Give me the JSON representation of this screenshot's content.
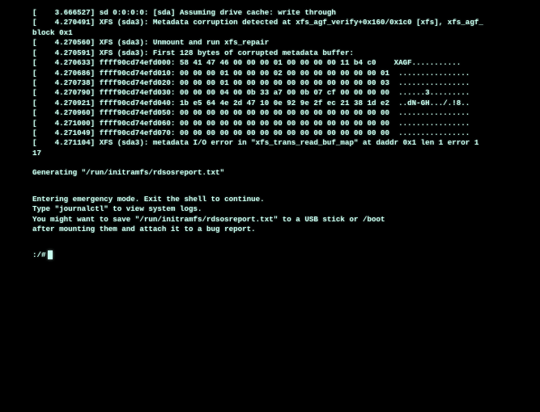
{
  "lines": [
    "[    3.666527] sd 0:0:0:0: [sda] Assuming drive cache: write through",
    "[    4.270491] XFS (sda3): Metadata corruption detected at xfs_agf_verify+0x160/0x1c0 [xfs], xfs_agf_",
    "block 0x1",
    "[    4.270560] XFS (sda3): Unmount and run xfs_repair",
    "[    4.270591] XFS (sda3): First 128 bytes of corrupted metadata buffer:",
    "[    4.270633] ffff90cd74efd000: 58 41 47 46 00 00 00 01 00 00 00 00 11 b4 c0    XAGF...........",
    "[    4.270686] ffff90cd74efd010: 00 00 00 01 00 00 00 02 00 00 00 00 00 00 00 01  ................",
    "[    4.270738] ffff90cd74efd020: 00 00 00 01 00 00 00 00 00 00 00 00 00 00 00 03  ................",
    "[    4.270790] ffff90cd74efd030: 00 00 00 04 00 0b 33 a7 00 0b 07 cf 00 00 00 00  ......3.........",
    "[    4.270921] ffff90cd74efd040: 1b e5 64 4e 2d 47 10 0e 92 9e 2f ec 21 38 1d e2  ..dN-GH.../.!8..",
    "[    4.270960] ffff90cd74efd050: 00 00 00 00 00 00 00 00 00 00 00 00 00 00 00 00  ................",
    "[    4.271000] ffff90cd74efd060: 00 00 00 00 00 00 00 00 00 00 00 00 00 00 00 00  ................",
    "[    4.271049] ffff90cd74efd070: 00 00 00 00 00 00 00 00 00 00 00 00 00 00 00 00  ................",
    "[    4.271104] XFS (sda3): metadata I/O error in \"xfs_trans_read_buf_map\" at daddr 0x1 len 1 error 1",
    "17"
  ],
  "generating": "Generating \"/run/initramfs/rdsosreport.txt\"",
  "emergency": [
    "Entering emergency mode. Exit the shell to continue.",
    "Type \"journalctl\" to view system logs.",
    "You might want to save \"/run/initramfs/rdsosreport.txt\" to a USB stick or /boot",
    "after mounting them and attach it to a bug report."
  ],
  "prompt": ":/#",
  "watermark": ""
}
